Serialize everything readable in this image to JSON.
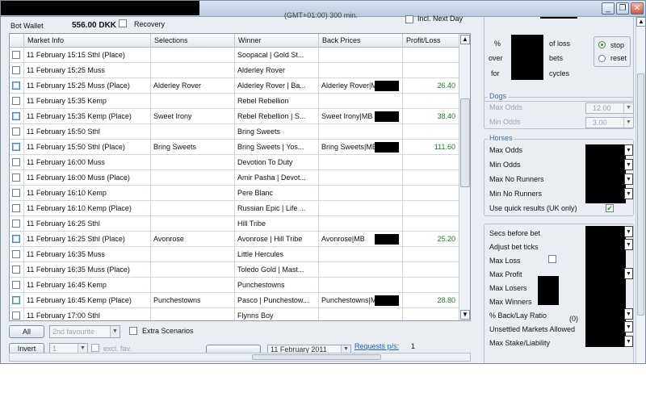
{
  "window": {
    "minimize_glyph": "_",
    "restore_glyph": "❐",
    "close_glyph": "✕"
  },
  "top": {
    "bot_wallet_label": "Bot Wallet",
    "bot_wallet_value": "556.00 DKK",
    "recovery_label": "Recovery",
    "time_info": "(GMT+01:00) 300 min.",
    "incl_next_day_label": "Incl. Next Day"
  },
  "grid": {
    "columns": [
      "Market Info",
      "Selections",
      "Winner",
      "Back Prices",
      "Profit/Loss"
    ],
    "rows": [
      {
        "market": "11 February 15:15  Sthl  (Place)",
        "selection": "",
        "winner": "Soopacal | Gold St...",
        "back": "",
        "profit": "",
        "sel": false
      },
      {
        "market": "11 February 15:25  Muss",
        "selection": "",
        "winner": "Alderley Rover",
        "back": "",
        "profit": "",
        "sel": false
      },
      {
        "market": "11 February 15:25  Muss  (Place)",
        "selection": "Alderley Rover",
        "winner": "Alderley Rover | Ba...",
        "back": "Alderley Rover|MB...",
        "profit": "26.40",
        "sel": true
      },
      {
        "market": "11 February 15:35  Kemp",
        "selection": "",
        "winner": "Rebel Rebellion",
        "back": "",
        "profit": "",
        "sel": false
      },
      {
        "market": "11 February 15:35  Kemp  (Place)",
        "selection": "Sweet Irony",
        "winner": "Rebel Rebellion | S...",
        "back": "Sweet Irony|MB",
        "profit": "38.40",
        "sel": true
      },
      {
        "market": "11 February 15:50  Sthl",
        "selection": "",
        "winner": "Bring Sweets",
        "back": "",
        "profit": "",
        "sel": false
      },
      {
        "market": "11 February 15:50  Sthl  (Place)",
        "selection": "Bring Sweets",
        "winner": "Bring Sweets | Yos...",
        "back": "Bring Sweets|MB",
        "profit": "111.60",
        "sel": true
      },
      {
        "market": "11 February 16:00  Muss",
        "selection": "",
        "winner": "Devotion To Duty",
        "back": "",
        "profit": "",
        "sel": false
      },
      {
        "market": "11 February 16:00  Muss  (Place)",
        "selection": "",
        "winner": "Amir Pasha | Devot...",
        "back": "",
        "profit": "",
        "sel": false
      },
      {
        "market": "11 February 16:10  Kemp",
        "selection": "",
        "winner": "Pere Blanc",
        "back": "",
        "profit": "",
        "sel": false
      },
      {
        "market": "11 February 16:10  Kemp  (Place)",
        "selection": "",
        "winner": "Russian Epic | Life ...",
        "back": "",
        "profit": "",
        "sel": false
      },
      {
        "market": "11 February 16:25  Sthl",
        "selection": "",
        "winner": "Hill Tribe",
        "back": "",
        "profit": "",
        "sel": false
      },
      {
        "market": "11 February 16:25  Sthl  (Place)",
        "selection": "Avonrose",
        "winner": "Avonrose | Hill Tribe",
        "back": "Avonrose|MB",
        "profit": "25.20",
        "sel": true
      },
      {
        "market": "11 February 16:35  Muss",
        "selection": "",
        "winner": "Little Hercules",
        "back": "",
        "profit": "",
        "sel": false
      },
      {
        "market": "11 February 16:35  Muss  (Place)",
        "selection": "",
        "winner": "Toledo Gold | Mast...",
        "back": "",
        "profit": "",
        "sel": false
      },
      {
        "market": "11 February 16:45  Kemp",
        "selection": "",
        "winner": "Punchestowns",
        "back": "",
        "profit": "",
        "sel": false
      },
      {
        "market": "11 February 16:45  Kemp  (Place)",
        "selection": "Punchestowns",
        "winner": "Pasco | Punchestow...",
        "back": "Punchestowns|MB",
        "profit": "28.80",
        "sel": true
      },
      {
        "market": "11 February 17:00  Sthl",
        "selection": "",
        "winner": "Flynns Boy",
        "back": "",
        "profit": "",
        "sel": false
      }
    ]
  },
  "bottom": {
    "all_button": "All",
    "favourite_combo": "2nd favourite",
    "extra_scenarios_label": "Extra Scenarios",
    "invert_button": "Invert",
    "number_combo": "1",
    "excl_fav_label": "excl. fav.",
    "date_combo": "11 February 2011",
    "requests_label": "Requests p/s:",
    "requests_value": "1"
  },
  "right": {
    "loss": {
      "pct": "%",
      "over": "over",
      "for": "for",
      "of_loss": "of loss",
      "bets": "bets",
      "cycles": "cycles",
      "stop": "stop",
      "reset": "reset"
    },
    "dogs": {
      "title": "Dogs",
      "max_odds_label": "Max Odds",
      "max_odds_value": "12.00",
      "min_odds_label": "Min Odds",
      "min_odds_value": "3.00"
    },
    "horses": {
      "title": "Horses",
      "max_odds_label": "Max Odds",
      "min_odds_label": "Min Odds",
      "max_no_runners_label": "Max No Runners",
      "min_no_runners_label": "Min No Runners",
      "quick_results_label": "Use quick results (UK only)"
    },
    "bet": {
      "secs_before_bet": "Secs before bet",
      "adjust_bet_ticks": "Adjust bet ticks",
      "max_loss": "Max Loss",
      "max_profit": "Max Profit",
      "max_losers": "Max Losers",
      "max_winners": "Max Winners",
      "back_lay_ratio": "% Back/Lay Ratio",
      "back_lay_value": "(0)",
      "unsettled": "Unsettled Markets Allowed",
      "max_stake": "Max Stake/Liability"
    }
  }
}
